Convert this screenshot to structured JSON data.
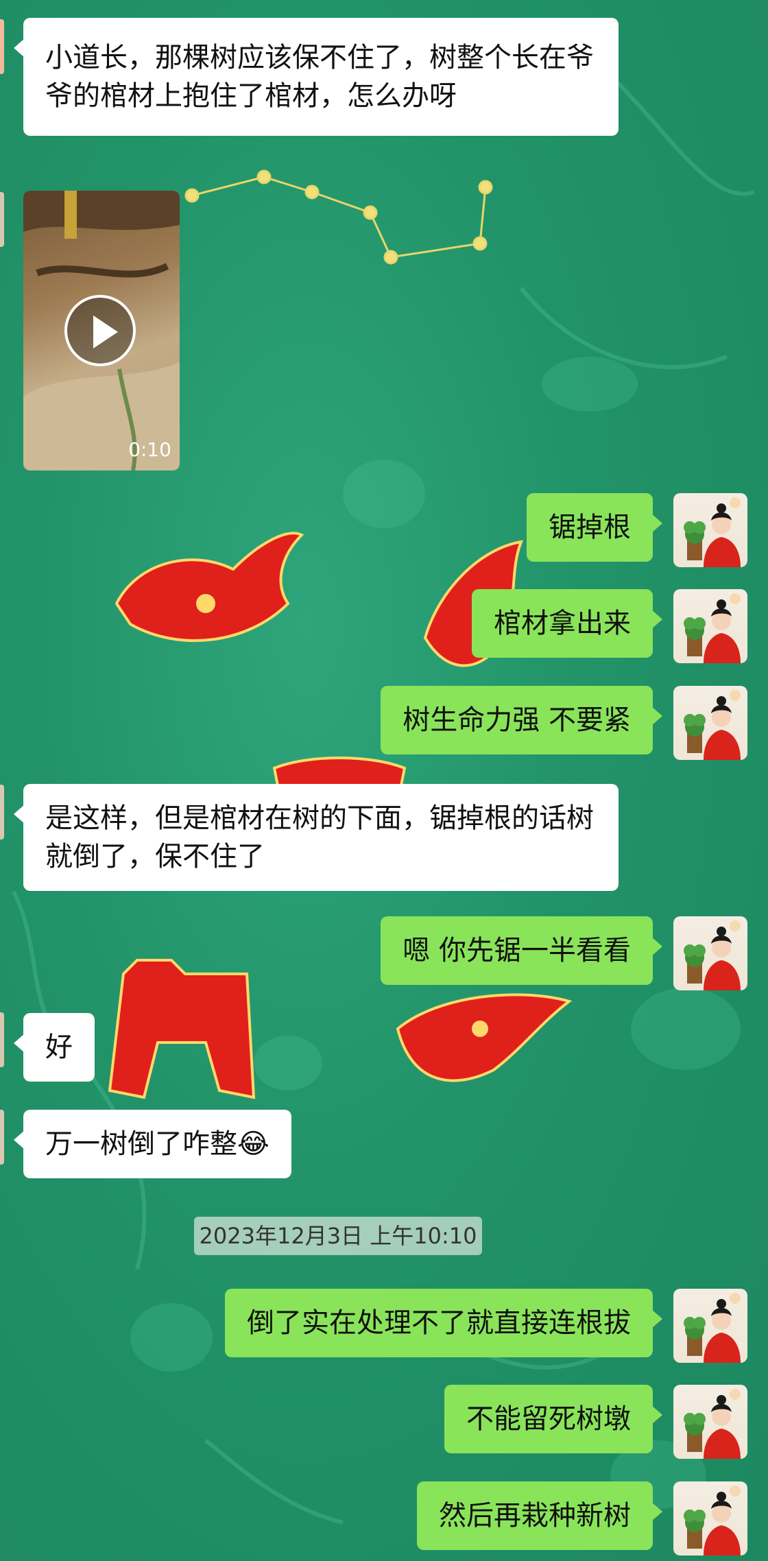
{
  "messages": [
    {
      "id": "m1",
      "side": "in",
      "text": "小道长，那棵树应该保不住了，树整个长在爷爷的棺材上抱住了棺材，怎么办呀"
    },
    {
      "id": "m2",
      "side": "in",
      "type": "video",
      "duration": "0:10"
    },
    {
      "id": "m3",
      "side": "out",
      "text": "锯掉根"
    },
    {
      "id": "m4",
      "side": "out",
      "text": "棺材拿出来"
    },
    {
      "id": "m5",
      "side": "out",
      "text": "树生命力强 不要紧"
    },
    {
      "id": "m6",
      "side": "in",
      "text": "是这样，但是棺材在树的下面，锯掉根的话树就倒了，保不住了"
    },
    {
      "id": "m7",
      "side": "out",
      "text": "嗯 你先锯一半看看"
    },
    {
      "id": "m8",
      "side": "in",
      "text": "好"
    },
    {
      "id": "m9",
      "side": "in",
      "text": "万一树倒了咋整😂"
    },
    {
      "id": "m10",
      "side": "out",
      "text": "倒了实在处理不了就直接连根拔"
    },
    {
      "id": "m11",
      "side": "out",
      "text": "不能留死树墩"
    },
    {
      "id": "m12",
      "side": "out",
      "text": "然后再栽种新树"
    }
  ],
  "timestamp": "2023年12月3日 上午10:10",
  "icons": {
    "play": "play-icon",
    "avatar": "avatar-icon"
  },
  "colors": {
    "background": "#229268",
    "bubble_out": "#89e45a",
    "bubble_in": "#ffffff",
    "decor_red": "#e0201a"
  }
}
